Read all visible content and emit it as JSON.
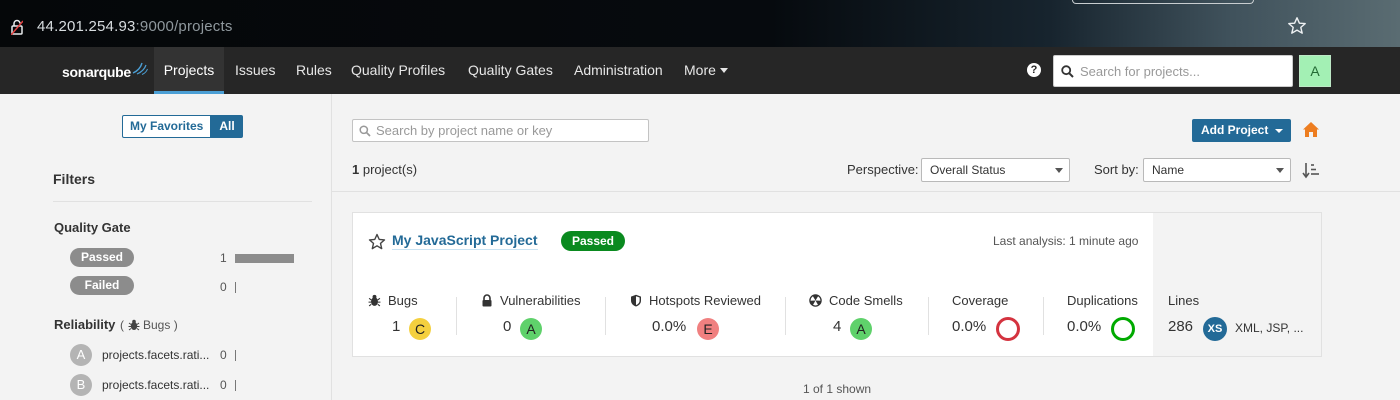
{
  "browser": {
    "url_host": "44.201.254.93",
    "url_path": ":9000/projects"
  },
  "nav": {
    "logo": "sonarqube",
    "items": [
      "Projects",
      "Issues",
      "Rules",
      "Quality Profiles",
      "Quality Gates",
      "Administration",
      "More"
    ],
    "search_placeholder": "Search for projects...",
    "avatar": "A"
  },
  "sidebar": {
    "favorites": "My Favorites",
    "all": "All",
    "filters_title": "Filters",
    "quality_gate": {
      "title": "Quality Gate",
      "options": [
        {
          "label": "Passed",
          "count": "1",
          "fraction": 1.0
        },
        {
          "label": "Failed",
          "count": "0",
          "fraction": 0
        }
      ]
    },
    "reliability": {
      "title": "Reliability",
      "open_paren": "(",
      "sub": "Bugs",
      "close_paren": ")",
      "options": [
        {
          "rating": "A",
          "label": "projects.facets.rati...",
          "count": "0"
        },
        {
          "rating": "B",
          "label": "projects.facets.rati...",
          "count": "0"
        }
      ]
    }
  },
  "main": {
    "search_placeholder": "Search by project name or key",
    "add_project": "Add Project",
    "count_num": "1",
    "count_text": " project(s)",
    "perspective_label": "Perspective:",
    "perspective_value": "Overall Status",
    "sortby_label": "Sort by:",
    "sortby_value": "Name",
    "shown": "1 of 1 shown"
  },
  "project": {
    "name": "My JavaScript Project",
    "status": "Passed",
    "last_analysis": "Last analysis: 1 minute ago",
    "metrics": {
      "bugs": {
        "title": "Bugs",
        "value": "1",
        "rating": "C"
      },
      "vulnerabilities": {
        "title": "Vulnerabilities",
        "value": "0",
        "rating": "A"
      },
      "hotspots": {
        "title": "Hotspots Reviewed",
        "value": "0.0%",
        "rating": "E"
      },
      "code_smells": {
        "title": "Code Smells",
        "value": "4",
        "rating": "A"
      },
      "coverage": {
        "title": "Coverage",
        "value": "0.0%"
      },
      "duplications": {
        "title": "Duplications",
        "value": "0.0%"
      },
      "lines": {
        "title": "Lines",
        "value": "286",
        "size": "XS",
        "languages": "XML, JSP, ..."
      }
    }
  },
  "colors": {
    "rating_a": "#5fd16b",
    "rating_c": "#f4d03f",
    "rating_e": "#f08080",
    "coverage_ring": "#d4333f",
    "duplication_ring": "#00aa00",
    "accent": "#236a97"
  }
}
